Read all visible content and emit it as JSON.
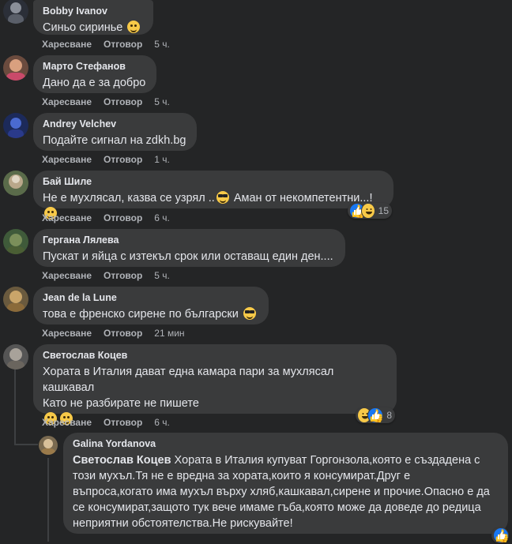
{
  "comments": [
    {
      "author": "Bobby Ivanov",
      "text": "Синьо сириньe",
      "emoji": "haha",
      "like": "Харесване",
      "reply": "Отговор",
      "time": "5 ч."
    },
    {
      "author": "Марто Стефанов",
      "text": "Дано да е за добро",
      "like": "Харесване",
      "reply": "Отговор",
      "time": "5 ч."
    },
    {
      "author": "Andrey Velchev",
      "text": "Подайте сигнал на zdkh.bg",
      "like": "Харесване",
      "reply": "Отговор",
      "time": "1 ч."
    },
    {
      "author": "Бай Шиле",
      "text": "Не е мухлясал, казва се узрял ..",
      "text2": " Аман от некомпетентни...!",
      "like": "Харесване",
      "reply": "Отговор",
      "time": "6 ч.",
      "reactions": "15"
    },
    {
      "author": "Гергана Лялева",
      "text": "Пускат и яйца с изтекъл срок или оставащ един ден....",
      "like": "Харесване",
      "reply": "Отговор",
      "time": "5 ч."
    },
    {
      "author": "Jean de la Lune",
      "text": "това е френско сирене по български",
      "like": "Харесване",
      "reply": "Отговор",
      "time": "21 мин"
    },
    {
      "author": "Светослав Коцев",
      "line1": "Хората в Италия дават една камара пари за мухлясал кашкавал",
      "line2": "Като не разбирате не пишете",
      "like": "Харесване",
      "reply": "Отговор",
      "time": "6 ч.",
      "reactions": "8"
    }
  ],
  "reply": {
    "author": "Galina Yordanova",
    "mention": "Светослав Коцев",
    "line1": " Хората в Италия купуват Горгонзола,която е създадена с",
    "line2": "този мухъл.Тя не е вредна за хората,които я консумират.Друг е",
    "line3": "въпроса,когато има мухъл върху хляб,кашкавал,сирене и прочие.Опасно е да",
    "line4": "се консумират,защото тук вече имаме гъба,която може да доведе до редица",
    "line5": "неприятни обстоятелства.Не рискувайте!"
  },
  "colors": {
    "background": "#242526",
    "bubble": "#3a3b3c",
    "text": "#e4e6eb",
    "muted": "#b0b3b8",
    "like_blue": "#1877f2"
  }
}
